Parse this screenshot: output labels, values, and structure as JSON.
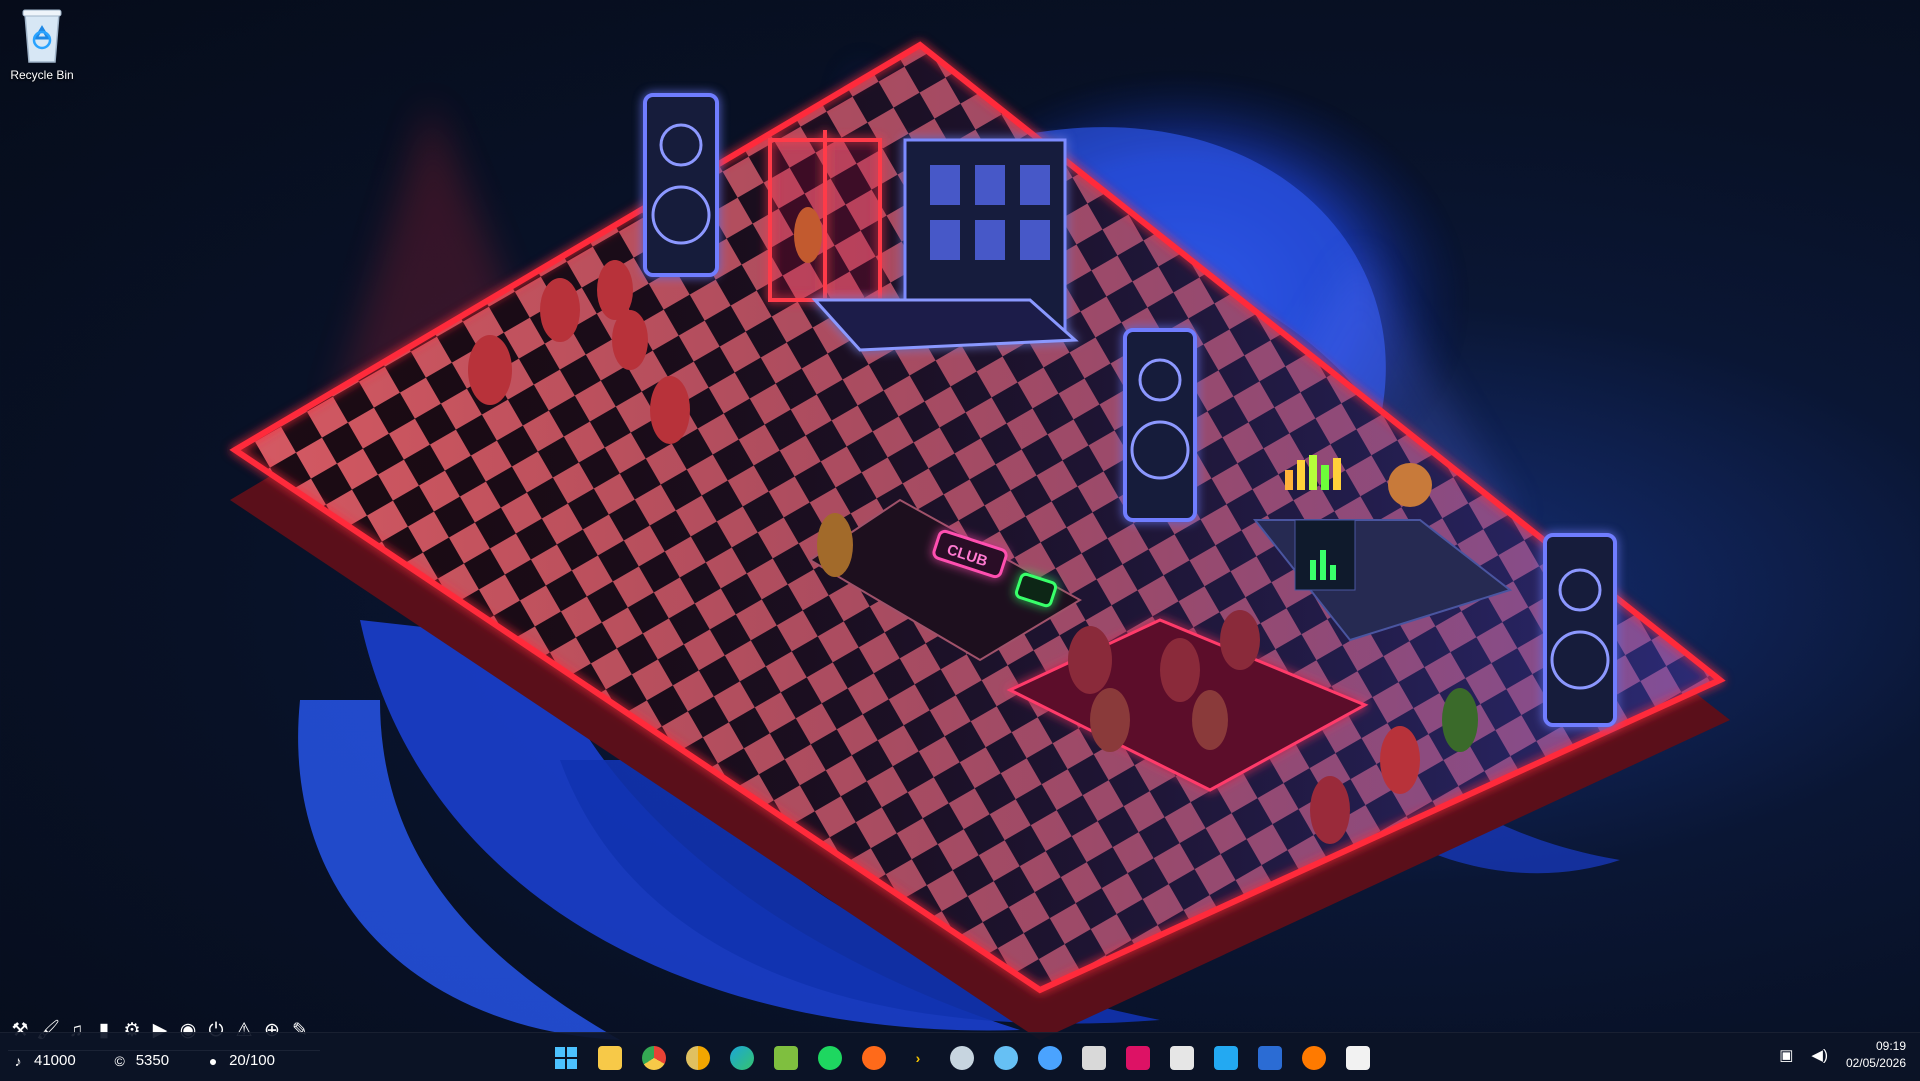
{
  "desktop": {
    "recycle_bin_label": "Recycle Bin"
  },
  "scene": {
    "club_sign": "CLUB"
  },
  "game_toolbar": {
    "icons": [
      "tools-icon",
      "brush-icon",
      "music-note-icon",
      "bar-chart-icon",
      "gear-icon",
      "camera-icon",
      "eye-gear-icon",
      "power-icon",
      "warning-icon",
      "zoom-icon",
      "paintbrush-icon"
    ]
  },
  "stats": {
    "music_value": "41000",
    "coins_value": "5350",
    "capacity_value": "20/100"
  },
  "taskbar": {
    "apps": [
      {
        "name": "start-button",
        "color": "#4cc2ff"
      },
      {
        "name": "file-explorer",
        "color": "#f7c948"
      },
      {
        "name": "chrome",
        "color": "#e94235"
      },
      {
        "name": "chrome-canary",
        "color": "#f2a600"
      },
      {
        "name": "edge",
        "color": "#1ba6d8"
      },
      {
        "name": "notepad-plus",
        "color": "#7fbf3f"
      },
      {
        "name": "spotify",
        "color": "#1ed760"
      },
      {
        "name": "soundcloud",
        "color": "#ff6a1a"
      },
      {
        "name": "terminal-arrow",
        "color": "#f5c400"
      },
      {
        "name": "steam",
        "color": "#c7d5e0"
      },
      {
        "name": "steam-alt",
        "color": "#66c0f4"
      },
      {
        "name": "app-drop",
        "color": "#4aa3ff"
      },
      {
        "name": "unity",
        "color": "#d9d9d9"
      },
      {
        "name": "rider",
        "color": "#dd1265"
      },
      {
        "name": "blender-box",
        "color": "#e6e6e6"
      },
      {
        "name": "vscode",
        "color": "#23a9f2"
      },
      {
        "name": "powershell",
        "color": "#2b6cd4"
      },
      {
        "name": "firefox-flame",
        "color": "#ff7a00"
      },
      {
        "name": "bot-app",
        "color": "#f2f2f2"
      }
    ]
  },
  "tray": {
    "time": "09:19",
    "date": "02/05/2026"
  },
  "colors": {
    "neon_red": "#ff2b3a",
    "neon_blue": "#3d5bff",
    "neon_green": "#39ff6a"
  }
}
